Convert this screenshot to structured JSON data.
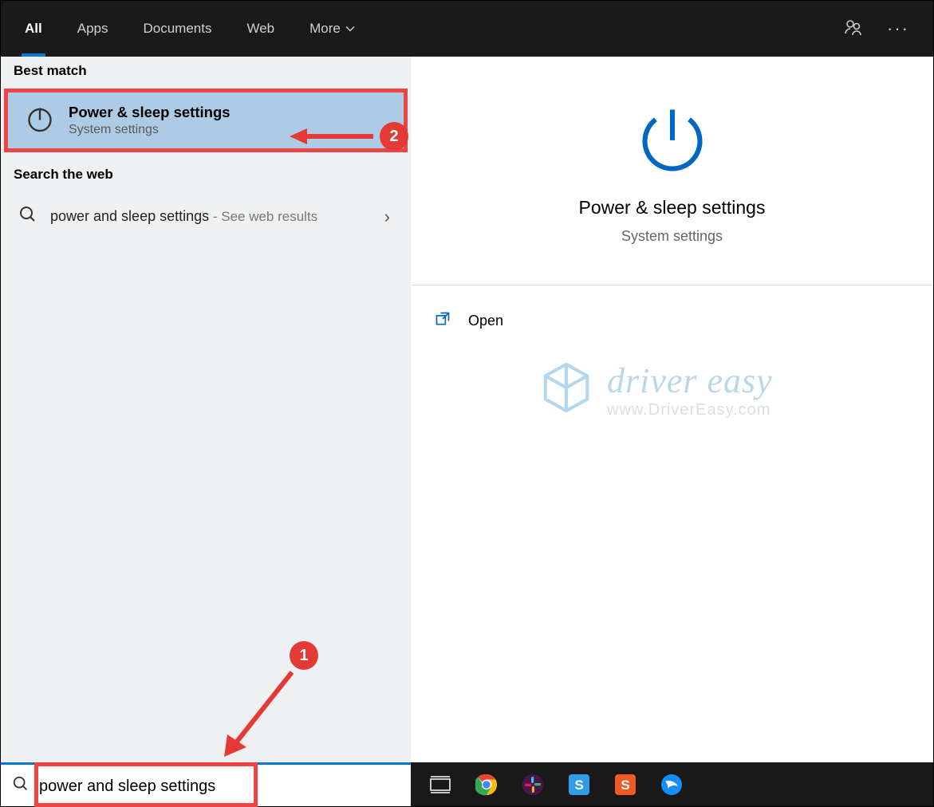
{
  "topbar": {
    "tabs": [
      "All",
      "Apps",
      "Documents",
      "Web",
      "More"
    ]
  },
  "left": {
    "best_match_label": "Best match",
    "best_match": {
      "title": "Power & sleep settings",
      "subtitle": "System settings"
    },
    "web_label": "Search the web",
    "web_item": {
      "query": "power and sleep settings",
      "suffix": " - See web results"
    }
  },
  "right": {
    "title": "Power & sleep settings",
    "subtitle": "System settings",
    "open_label": "Open"
  },
  "watermark": {
    "brand": "driver easy",
    "url": "www.DriverEasy.com"
  },
  "search": {
    "value": "power and sleep settings"
  },
  "callouts": {
    "one": "1",
    "two": "2"
  }
}
